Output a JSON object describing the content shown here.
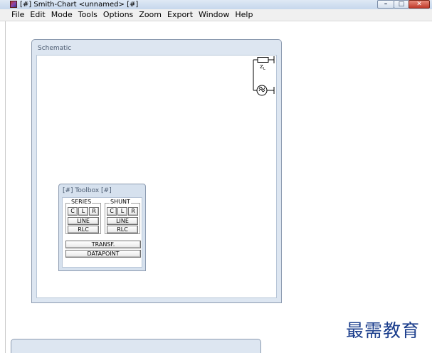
{
  "window": {
    "title": "[#] Smith-Chart <unnamed> [#]",
    "app_icon": "smith-chart-app-icon",
    "minimize_glyph": "–",
    "maximize_glyph": "□",
    "close_glyph": "✕"
  },
  "menu": {
    "items": [
      "File",
      "Edit",
      "Mode",
      "Tools",
      "Options",
      "Zoom",
      "Export",
      "Window",
      "Help"
    ]
  },
  "schematic": {
    "title": "Schematic",
    "load_label": "Z",
    "load_label_sub": "L",
    "source_icon": "signal-source-icon"
  },
  "toolbox": {
    "title": "[#] Toolbox [#]",
    "series": {
      "label": "SERIES",
      "c": "C",
      "l": "L",
      "r": "R",
      "line": "LINE",
      "rlc": "RLC"
    },
    "shunt": {
      "label": "SHUNT",
      "c": "C",
      "l": "L",
      "r": "R",
      "line": "LINE",
      "rlc": "RLC"
    },
    "transf": "TRANSF.",
    "datapoint": "DATAPOINT"
  },
  "watermark": {
    "text": "最需教育"
  },
  "colors": {
    "window_bg": "#dde6f1",
    "watermark": "#1a3d8c",
    "close_button": "#c0392b"
  }
}
